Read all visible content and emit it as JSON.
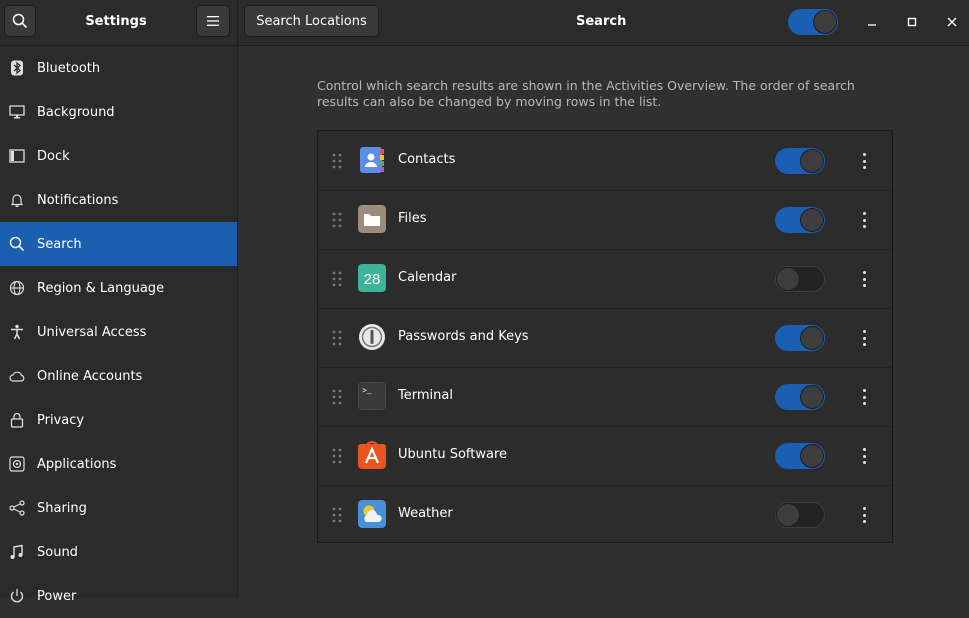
{
  "left_header": {
    "title": "Settings"
  },
  "right_header": {
    "locations_button": "Search Locations",
    "title": "Search",
    "master_toggle_on": true
  },
  "sidebar": {
    "items": [
      {
        "label": "Bluetooth",
        "icon": "bluetooth-icon"
      },
      {
        "label": "Background",
        "icon": "display-icon"
      },
      {
        "label": "Dock",
        "icon": "dock-icon"
      },
      {
        "label": "Notifications",
        "icon": "bell-icon"
      },
      {
        "label": "Search",
        "icon": "search-icon",
        "active": true
      },
      {
        "label": "Region & Language",
        "icon": "globe-icon"
      },
      {
        "label": "Universal Access",
        "icon": "accessibility-icon"
      },
      {
        "label": "Online Accounts",
        "icon": "cloud-icon"
      },
      {
        "label": "Privacy",
        "icon": "lock-icon"
      },
      {
        "label": "Applications",
        "icon": "applications-icon"
      },
      {
        "label": "Sharing",
        "icon": "share-icon"
      },
      {
        "label": "Sound",
        "icon": "music-note-icon"
      },
      {
        "label": "Power",
        "icon": "power-icon"
      }
    ]
  },
  "main": {
    "description": "Control which search results are shown in the Activities Overview. The order of search results can also be changed by moving rows in the list.",
    "apps": [
      {
        "label": "Contacts",
        "icon": "contacts-icon",
        "enabled": true
      },
      {
        "label": "Files",
        "icon": "files-icon",
        "enabled": true
      },
      {
        "label": "Calendar",
        "icon": "calendar-icon",
        "enabled": false,
        "icon_text": "28"
      },
      {
        "label": "Passwords and Keys",
        "icon": "passwords-keys-icon",
        "enabled": true
      },
      {
        "label": "Terminal",
        "icon": "terminal-icon",
        "enabled": true,
        "icon_text": ">_"
      },
      {
        "label": "Ubuntu Software",
        "icon": "ubuntu-software-icon",
        "enabled": true
      },
      {
        "label": "Weather",
        "icon": "weather-icon",
        "enabled": false
      }
    ]
  },
  "colors": {
    "accent": "#1c5fb1",
    "background": "#303030",
    "sidebar": "#2b2b2b"
  }
}
